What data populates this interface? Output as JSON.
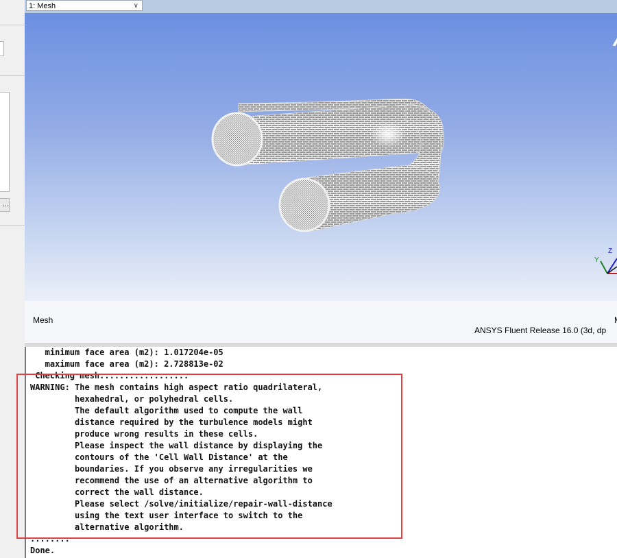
{
  "top_bar": {
    "window_selector": "1: Mesh"
  },
  "viewport": {
    "caption_left": "Mesh",
    "caption_right_top": "M",
    "release": "ANSYS Fluent Release 16.0 (3d, dp",
    "corner_glyph": "A",
    "axes": {
      "z": "Z",
      "y": "Y"
    }
  },
  "left_panel": {
    "button_label": "..."
  },
  "console": {
    "lines": [
      "   minimum face area (m2): 1.017204e-05",
      "   maximum face area (m2): 2.728813e-02",
      " Checking mesh..................",
      "WARNING: The mesh contains high aspect ratio quadrilateral,",
      "         hexahedral, or polyhedral cells.",
      "         The default algorithm used to compute the wall",
      "         distance required by the turbulence models might",
      "         produce wrong results in these cells.",
      "         Please inspect the wall distance by displaying the",
      "         contours of the 'Cell Wall Distance' at the",
      "         boundaries. If you observe any irregularities we",
      "         recommend the use of an alternative algorithm to",
      "         correct the wall distance.",
      "         Please select /solve/initialize/repair-wall-distance",
      "         using the text user interface to switch to the",
      "         alternative algorithm.",
      "........",
      "Done."
    ]
  },
  "colors": {
    "highlight": "#e04040",
    "accent_bg": "#b9cbe2"
  }
}
